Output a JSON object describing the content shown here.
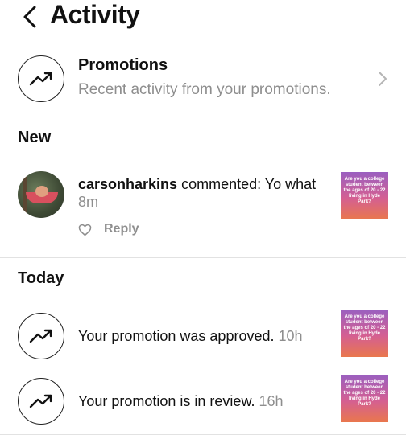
{
  "header": {
    "title": "Activity"
  },
  "promotions": {
    "title": "Promotions",
    "subtitle": "Recent activity from your promotions."
  },
  "sections": {
    "new_title": "New",
    "today_title": "Today"
  },
  "comment": {
    "username": "carsonharkins",
    "text": " commented: Yo what",
    "time": "8m",
    "reply_label": "Reply",
    "thumb_text": "Are you a college student between the ages of 20 - 22 living in Hyde Park?"
  },
  "activities": [
    {
      "text": "Your promotion was approved.",
      "time": "10h",
      "thumb_text": "Are you a college student between the ages of 20 - 22 living in Hyde Park?"
    },
    {
      "text": "Your promotion is in review.",
      "time": "16h",
      "thumb_text": "Are you a college student between the ages of 20 - 22 living in Hyde Park?"
    }
  ],
  "icons": {
    "back": "chevron-left-icon",
    "promotions": "trending-up-icon",
    "forward": "chevron-right-icon",
    "like": "heart-icon"
  },
  "colors": {
    "secondary_text": "#8e8e8e",
    "divider": "#e2e2e2",
    "thumb_gradient_top": "#9a5fc0",
    "thumb_gradient_bottom": "#e9774d"
  }
}
